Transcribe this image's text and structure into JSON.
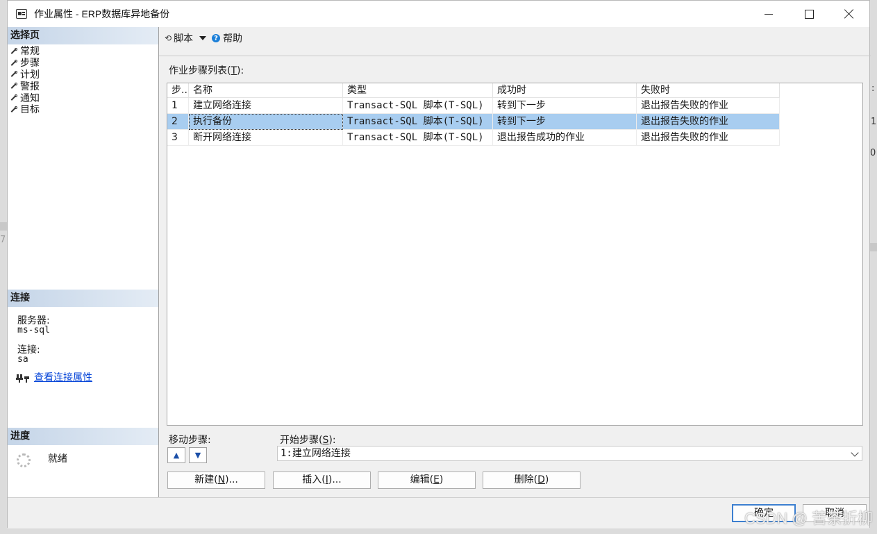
{
  "window": {
    "title": "作业属性 - ERP数据库异地备份"
  },
  "left": {
    "select_page_header": "选择页",
    "nav_items": [
      "常规",
      "步骤",
      "计划",
      "警报",
      "通知",
      "目标"
    ],
    "connection_header": "连接",
    "server_label": "服务器:",
    "server_value": "ms-sql",
    "connection_label": "连接:",
    "connection_value": "sa",
    "view_connection_link": "查看连接属性",
    "progress_header": "进度",
    "progress_status": "就绪"
  },
  "toolbar": {
    "script_label": "脚本",
    "help_label": "帮助"
  },
  "steps": {
    "list_label": "作业步骤列表(",
    "list_label_key": "T",
    "list_label_end": "):",
    "columns": [
      "步...",
      "名称",
      "类型",
      "成功时",
      "失败时"
    ],
    "rows": [
      {
        "step": "1",
        "name": "建立网络连接",
        "type": "Transact-SQL 脚本(T-SQL)",
        "on_success": "转到下一步",
        "on_failure": "退出报告失败的作业"
      },
      {
        "step": "2",
        "name": "执行备份",
        "type": "Transact-SQL 脚本(T-SQL)",
        "on_success": "转到下一步",
        "on_failure": "退出报告失败的作业"
      },
      {
        "step": "3",
        "name": "断开网络连接",
        "type": "Transact-SQL 脚本(T-SQL)",
        "on_success": "退出报告成功的作业",
        "on_failure": "退出报告失败的作业"
      }
    ],
    "selected_row": 1
  },
  "controls": {
    "move_step_label": "移动步骤:",
    "start_step_label": "开始步骤(",
    "start_step_key": "S",
    "start_step_end": "):",
    "start_step_value": "1:建立网络连接",
    "new_button": {
      "pre": "新建(",
      "key": "N",
      "post": ")..."
    },
    "insert_button": {
      "pre": "插入(",
      "key": "I",
      "post": ")..."
    },
    "edit_button": {
      "pre": "编辑(",
      "key": "E",
      "post": ")"
    },
    "delete_button": {
      "pre": "删除(",
      "key": "D",
      "post": ")"
    }
  },
  "footer": {
    "ok_label": "确定",
    "cancel_label": "取消"
  },
  "watermark": "CSDN @ 苦茶折柳",
  "background_fragments": [
    ":",
    "1",
    "0",
    "7"
  ],
  "colors": {
    "selected_row": "#a8cdf0",
    "section_header": "#c5d5e8",
    "link": "#0645d8",
    "primary_border": "#3c7fd0"
  }
}
